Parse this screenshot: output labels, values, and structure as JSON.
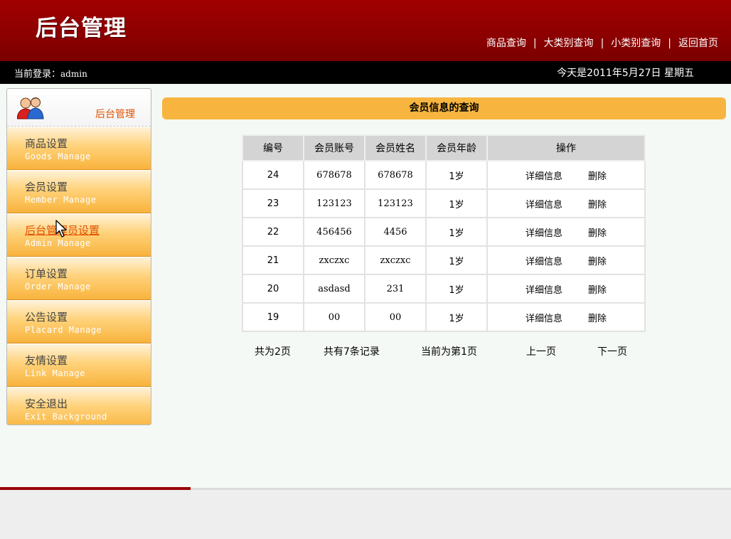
{
  "header": {
    "logo_text": "后台管理",
    "nav": [
      {
        "label": "商品查询"
      },
      {
        "label": "大类别查询"
      },
      {
        "label": "小类别查询"
      },
      {
        "label": "返回首页"
      }
    ],
    "separator": "|",
    "colors": {
      "header_bg": "#8c0000",
      "infobar_bg": "#000000"
    }
  },
  "infobar": {
    "login_label": "当前登录：",
    "username": "admin",
    "date_text": "今天是2011年5月27日  星期五"
  },
  "sidebar": {
    "title": "后台管理",
    "avatar_icon": "users-icon",
    "active_index": 2,
    "items": [
      {
        "cn": "商品设置",
        "en": "Goods Manage"
      },
      {
        "cn": "会员设置",
        "en": "Member Manage"
      },
      {
        "cn": "后台管理员设置",
        "en": "Admin Manage"
      },
      {
        "cn": "订单设置",
        "en": "Order Manage"
      },
      {
        "cn": "公告设置",
        "en": "Placard Manage"
      },
      {
        "cn": "友情设置",
        "en": "Link Manage"
      },
      {
        "cn": "安全退出",
        "en": "Exit Background"
      }
    ]
  },
  "main": {
    "title": "会员信息的查询",
    "table": {
      "headers": [
        "编号",
        "会员账号",
        "会员姓名",
        "会员年龄",
        "操作"
      ],
      "rows": [
        {
          "id": "24",
          "account": "678678",
          "name": "678678",
          "age": "1岁"
        },
        {
          "id": "23",
          "account": "123123",
          "name": "123123",
          "age": "1岁"
        },
        {
          "id": "22",
          "account": "456456",
          "name": "4456",
          "age": "1岁"
        },
        {
          "id": "21",
          "account": "zxczxc",
          "name": "zxczxc",
          "age": "1岁"
        },
        {
          "id": "20",
          "account": "asdasd",
          "name": "231",
          "age": "1岁"
        },
        {
          "id": "19",
          "account": "00",
          "name": "00",
          "age": "1岁"
        }
      ],
      "detail_label": "详细信息",
      "delete_label": "删除"
    },
    "pager": {
      "total_pages": "共为2页",
      "total_records": "共有7条记录",
      "current_page": "当前为第1页",
      "prev": "上一页",
      "next": "下一页"
    }
  },
  "accent_colors": {
    "title_bar": "#f7b540",
    "menu_orange": "#f8b33d",
    "active_text": "#e05000"
  }
}
